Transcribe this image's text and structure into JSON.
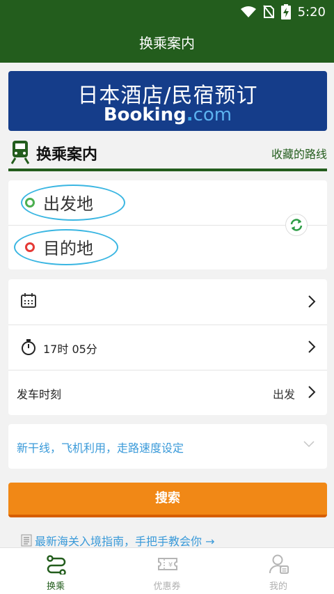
{
  "status_bar": {
    "time": "5:20"
  },
  "app_bar": {
    "title": "换乘案内"
  },
  "banner": {
    "line1": "日本酒店/民宿预订",
    "brand_part1": "Booking",
    "brand_dot": ".",
    "brand_part2": "com"
  },
  "section": {
    "title": "换乘案内",
    "favorite_routes_link": "收藏的路线"
  },
  "stations": {
    "departure_placeholder": "出发地",
    "destination_placeholder": "目的地"
  },
  "settings": {
    "date_value": "",
    "time_value": "17时 05分",
    "mode_label": "发车时刻",
    "mode_value": "出发"
  },
  "options": {
    "label": "新干线，飞机利用，走路速度设定"
  },
  "search_button": {
    "label": "搜索"
  },
  "guide": {
    "text": "最新海关入境指南，手把手教会你 →"
  },
  "bottom_nav": {
    "items": [
      {
        "label": "换乘",
        "icon": "route-icon",
        "active": true
      },
      {
        "label": "优惠券",
        "icon": "coupon-icon",
        "active": false
      },
      {
        "label": "我的",
        "icon": "profile-icon",
        "active": false
      }
    ]
  },
  "colors": {
    "primary_green": "#235d1d",
    "booking_blue": "#153d8a",
    "search_orange": "#f18816",
    "link_blue": "#3a9ad9",
    "departure_ring": "#4caf50",
    "destination_ring": "#e53935",
    "highlight_ellipse": "#3ab6e2"
  }
}
